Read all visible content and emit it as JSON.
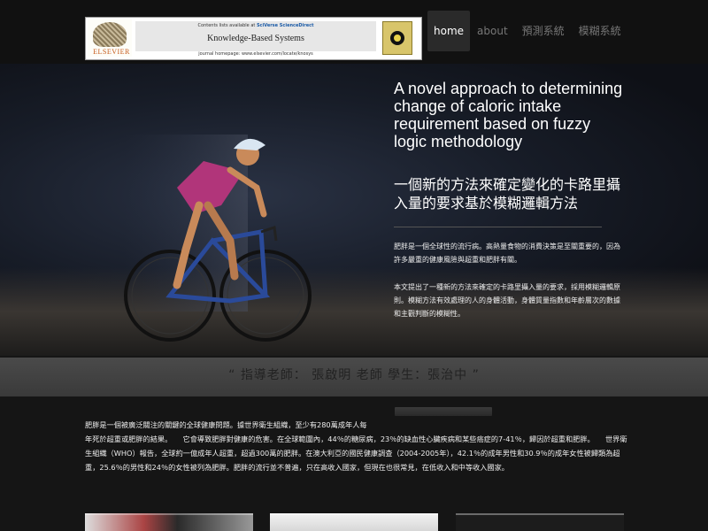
{
  "banner": {
    "publisher": "ELSEVIER",
    "contents_prefix": "Contents lists available at",
    "contents_link": "SciVerse ScienceDirect",
    "journal_title": "Knowledge-Based Systems",
    "journal_homepage": "journal homepage: www.elsevier.com/locate/knosys"
  },
  "nav": {
    "items": [
      "home",
      "about",
      "預測系統",
      "模糊系統"
    ],
    "active": "home"
  },
  "hero": {
    "title_en": "A novel approach to determining change of caloric intake requirement based on fuzzy logic methodology",
    "title_zh": "一個新的方法來確定變化的卡路里攝入量的要求基於模糊邏輯方法",
    "para1": "肥胖是一個全球性的流行病。高熱量食物的消費決策是至關重要的，因為許多嚴重的健康風險與超重和肥胖有關。",
    "para2": "本文提出了一種新的方法來確定的卡路里攝入量的要求，採用模糊邏輯原則。模糊方法有效處理的人的身體活動，身體質量指數和年齡層次的數據和主觀判斷的模糊性。"
  },
  "quote": "“ 指導老師： 張啟明 老師 學生：張治中 ”",
  "body": {
    "line1": "肥胖是一個被廣泛關注的關鍵的全球健康問題。據世界衛生組織，至少有280萬成年人每",
    "rest": "年死於超重或肥胖的結果。　　它會導致肥胖對健康的危害。在全球範圍內，44％的糖尿病，23％的缺血性心臟疾病和某些癌症的7-41％，歸因於超重和肥胖。　　世界衛生組織（WHO）報告，全球約一億成年人超重，超過300萬的肥胖。在澳大利亞的國民健康調查（2004-2005年），42.1％的成年男性和30.9％的成年女性被歸類為超重，25.6％的男性和24％的女性被列為肥胖。肥胖的流行並不普遍，只在高收入國家，但現在也很常見，在低收入和中等收入國家。"
  }
}
